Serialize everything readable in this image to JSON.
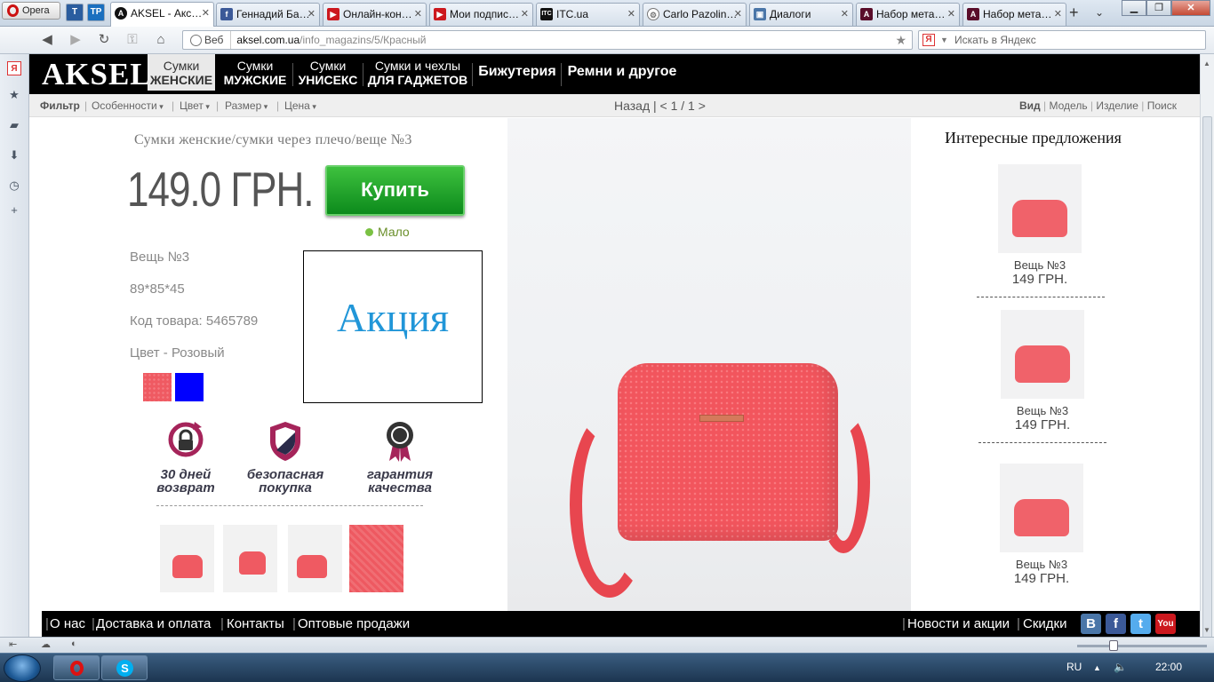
{
  "browser": {
    "menu_label": "Opera",
    "tabs": [
      {
        "title": "AKSEL - Акс…",
        "icon_color": "#111111"
      },
      {
        "title": "Геннадий Ба…",
        "icon_color": "#3b5998"
      },
      {
        "title": "Онлайн-кон…",
        "icon_color": "#cc181e"
      },
      {
        "title": "Мои подпис…",
        "icon_color": "#cc181e"
      },
      {
        "title": "ITC.ua",
        "icon_color": "#111111"
      },
      {
        "title": "Carlo Pazolin…",
        "icon_color": "#777777"
      },
      {
        "title": "Диалоги",
        "icon_color": "#4a76a8"
      },
      {
        "title": "Набор мета…",
        "icon_color": "#5a0d2a"
      },
      {
        "title": "Набор мета…",
        "icon_color": "#5a0d2a"
      }
    ],
    "address": {
      "scheme_label": "Веб",
      "host": "aksel.com.ua",
      "path": "/info_magazins/5/Красный"
    },
    "search_placeholder": "Искать в Яндекс"
  },
  "site": {
    "logo": "AKSEL",
    "categories": [
      {
        "line1": "Сумки",
        "line2": "ЖЕНСКИЕ"
      },
      {
        "line1": "Сумки",
        "line2": "МУЖСКИЕ"
      },
      {
        "line1": "Сумки",
        "line2": "УНИСЕКС"
      },
      {
        "line1": "Сумки и чехлы",
        "line2": "ДЛЯ ГАДЖЕТОВ"
      },
      {
        "line1": "Бижутерия",
        "line2": ""
      },
      {
        "line1": "Ремни и другое",
        "line2": ""
      }
    ],
    "filter": {
      "label": "Фильтр",
      "options": [
        "Особенности",
        "Цвет",
        "Размер",
        "Цена"
      ],
      "pager": "Назад | < 1 / 1 >",
      "view_links": [
        "Вид",
        "Модель",
        "Изделие",
        "Поиск"
      ]
    }
  },
  "product": {
    "breadcrumb": "Сумки женские/сумки через плечо/веще №3",
    "price": "149.0 ГРН.",
    "buy_label": "Купить",
    "stock_label": "Мало",
    "name": "Вещь №3",
    "dimensions": "89*85*45",
    "code": "Код товара: 5465789",
    "color": "Цвет - Розовый",
    "swatches": [
      "#ef5a62",
      "#0000ff"
    ],
    "promo_label": "Акция",
    "badges": [
      {
        "line1": "30 дней",
        "line2": "возврат"
      },
      {
        "line1": "безопасная",
        "line2": "покупка"
      },
      {
        "line1": "гарантия",
        "line2": "качества"
      }
    ],
    "accent_color": "#ef5a62"
  },
  "offers": {
    "title": "Интересные предложения",
    "items": [
      {
        "name": "Вещь №3",
        "price": "149 ГРН."
      },
      {
        "name": "Вещь №3",
        "price": "149 ГРН."
      },
      {
        "name": "Вещь №3",
        "price": "149 ГРН."
      }
    ]
  },
  "footer": {
    "left_links": [
      "О нас",
      "Доставка и оплата",
      "Контакты",
      "Оптовые продажи"
    ],
    "right_links": [
      "Новости и акции",
      "Скидки"
    ],
    "social": [
      {
        "icon": "vk-icon",
        "glyph": "В",
        "color": "#4a76a8"
      },
      {
        "icon": "facebook-icon",
        "glyph": "f",
        "color": "#3b5998"
      },
      {
        "icon": "twitter-icon",
        "glyph": "t",
        "color": "#55acee"
      },
      {
        "icon": "youtube-icon",
        "glyph": "You",
        "color": "#cc181e"
      }
    ]
  },
  "taskbar": {
    "lang": "RU",
    "clock": "22:00"
  }
}
